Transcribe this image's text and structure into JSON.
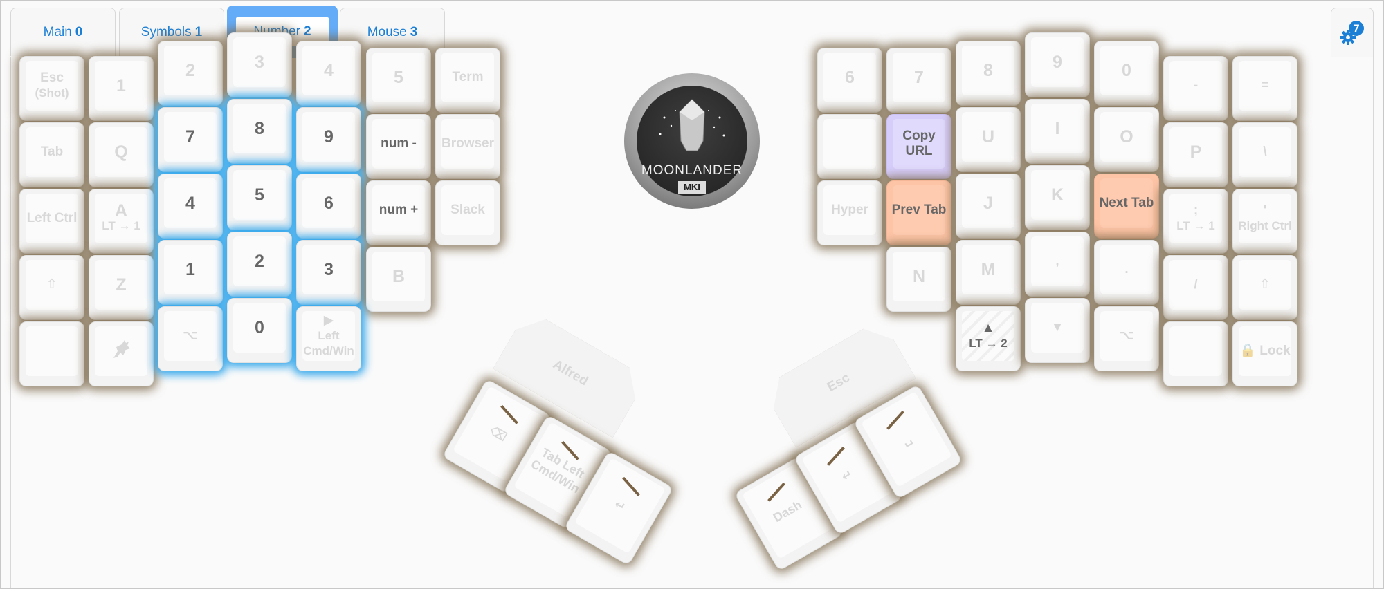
{
  "tabs": [
    {
      "label": "Main",
      "num": "0",
      "active": false
    },
    {
      "label": "Symbols",
      "num": "1",
      "active": false
    },
    {
      "label": "Number",
      "num": "2",
      "active": true
    },
    {
      "label": "Mouse",
      "num": "3",
      "active": false
    }
  ],
  "settings": {
    "badge": "7",
    "icon": "gear-icon"
  },
  "logo": {
    "title": "MOONLANDER",
    "subtitle": "MKI"
  },
  "left_keys": [
    {
      "label": "Esc",
      "sub": "(Shot)"
    },
    {
      "label": "1"
    },
    {
      "label": "2"
    },
    {
      "label": "3"
    },
    {
      "label": "4"
    },
    {
      "label": "5"
    },
    {
      "label": "Term"
    },
    {
      "label": "Tab"
    },
    {
      "label": "Q"
    },
    {
      "label": "7",
      "active": true
    },
    {
      "label": "8",
      "active": true
    },
    {
      "label": "9",
      "active": true
    },
    {
      "label": "num -",
      "active": true
    },
    {
      "label": "Browser"
    },
    {
      "label": "Left Ctrl"
    },
    {
      "label": "A",
      "sub": "LT → 1"
    },
    {
      "label": "4",
      "active": true
    },
    {
      "label": "5",
      "active": true
    },
    {
      "label": "6",
      "active": true
    },
    {
      "label": "num +",
      "active": true
    },
    {
      "label": "Slack"
    },
    {
      "label": "⇧"
    },
    {
      "label": "Z"
    },
    {
      "label": "1",
      "active": true
    },
    {
      "label": "2",
      "active": true
    },
    {
      "label": "3",
      "active": true
    },
    {
      "label": "B"
    },
    {
      "label": ""
    },
    {
      "label": "goat-icon"
    },
    {
      "label": "⌥"
    },
    {
      "label": "0",
      "active": true
    },
    {
      "label": "▶",
      "sub": "Left Cmd/Win"
    }
  ],
  "right_keys": [
    {
      "label": "6"
    },
    {
      "label": "7"
    },
    {
      "label": "8"
    },
    {
      "label": "9"
    },
    {
      "label": "0"
    },
    {
      "label": "-"
    },
    {
      "label": "="
    },
    {
      "label": ""
    },
    {
      "label": "Copy URL",
      "active": true,
      "color": "#d6cdfb"
    },
    {
      "label": "U"
    },
    {
      "label": "I"
    },
    {
      "label": "O"
    },
    {
      "label": "P"
    },
    {
      "label": "\\"
    },
    {
      "label": "Hyper"
    },
    {
      "label": "Prev Tab",
      "active": true,
      "color": "#fdc4a6"
    },
    {
      "label": "J"
    },
    {
      "label": "K"
    },
    {
      "label": "Next Tab",
      "active": true,
      "color": "#fdc4a6"
    },
    {
      "label": ";",
      "sub": "LT → 1"
    },
    {
      "label": "'",
      "sub": "Right Ctrl"
    },
    {
      "label": "N"
    },
    {
      "label": "M"
    },
    {
      "label": ","
    },
    {
      "label": "."
    },
    {
      "label": "/"
    },
    {
      "label": "⇧"
    },
    {
      "label": "▲",
      "sub": "LT → 2",
      "active": true
    },
    {
      "label": "▼"
    },
    {
      "label": "⌥"
    },
    {
      "label": ""
    },
    {
      "label": "Lock"
    }
  ],
  "left_thumb": {
    "top": "Alfred",
    "keys": [
      "⌫",
      "Tab Left Cmd/Win",
      "↵"
    ]
  },
  "right_thumb": {
    "top": "Esc",
    "keys": [
      "Dash",
      "↵",
      "␣"
    ]
  }
}
